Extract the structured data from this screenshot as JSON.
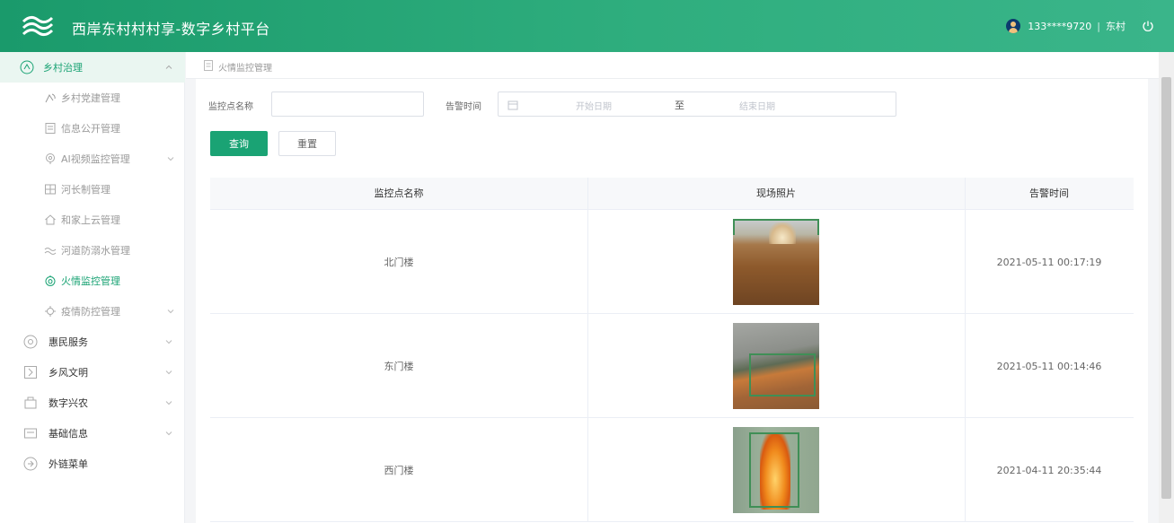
{
  "header": {
    "app_title": "西岸东村村村享-数字乡村平台",
    "user_phone": "133****9720",
    "divider": "|",
    "user_org": "东村"
  },
  "sidebar": {
    "groups": [
      {
        "label": "乡村治理",
        "icon": "governance-icon",
        "expanded": true
      },
      {
        "label": "惠民服务",
        "icon": "service-icon"
      },
      {
        "label": "乡风文明",
        "icon": "civilization-icon"
      },
      {
        "label": "数字兴农",
        "icon": "agriculture-icon"
      },
      {
        "label": "基础信息",
        "icon": "info-icon"
      },
      {
        "label": "外链菜单",
        "icon": "link-icon"
      }
    ],
    "sub_items": [
      {
        "label": "乡村党建管理",
        "icon": "party-icon"
      },
      {
        "label": "信息公开管理",
        "icon": "document-icon"
      },
      {
        "label": "AI视频监控管理",
        "icon": "camera-icon"
      },
      {
        "label": "河长制管理",
        "icon": "river-icon"
      },
      {
        "label": "和家上云管理",
        "icon": "home-cloud-icon"
      },
      {
        "label": "河道防溺水管理",
        "icon": "water-icon"
      },
      {
        "label": "火情监控管理",
        "icon": "fire-icon",
        "active": true
      },
      {
        "label": "疫情防控管理",
        "icon": "epidemic-icon"
      }
    ]
  },
  "breadcrumb": {
    "current": "火情监控管理"
  },
  "filters": {
    "monitor_name_label": "监控点名称",
    "monitor_name_value": "",
    "alarm_time_label": "告警时间",
    "start_placeholder": "开始日期",
    "range_separator": "至",
    "end_placeholder": "结束日期",
    "query_button": "查询",
    "reset_button": "重置"
  },
  "table": {
    "columns": [
      "监控点名称",
      "现场照片",
      "告警时间"
    ],
    "rows": [
      {
        "name": "北门楼",
        "photo": "fire-scene-photo-1",
        "time": "2021-05-11 00:17:19"
      },
      {
        "name": "东门楼",
        "photo": "fire-scene-photo-2",
        "time": "2021-05-11 00:14:46"
      },
      {
        "name": "西门楼",
        "photo": "fire-scene-photo-3",
        "time": "2021-04-11 20:35:44"
      }
    ]
  },
  "colors": {
    "header_start": "#1a9a6b",
    "header_end": "#3ab58a",
    "primary": "#1aa374",
    "active_menu_bg": "#eaf6f1"
  }
}
